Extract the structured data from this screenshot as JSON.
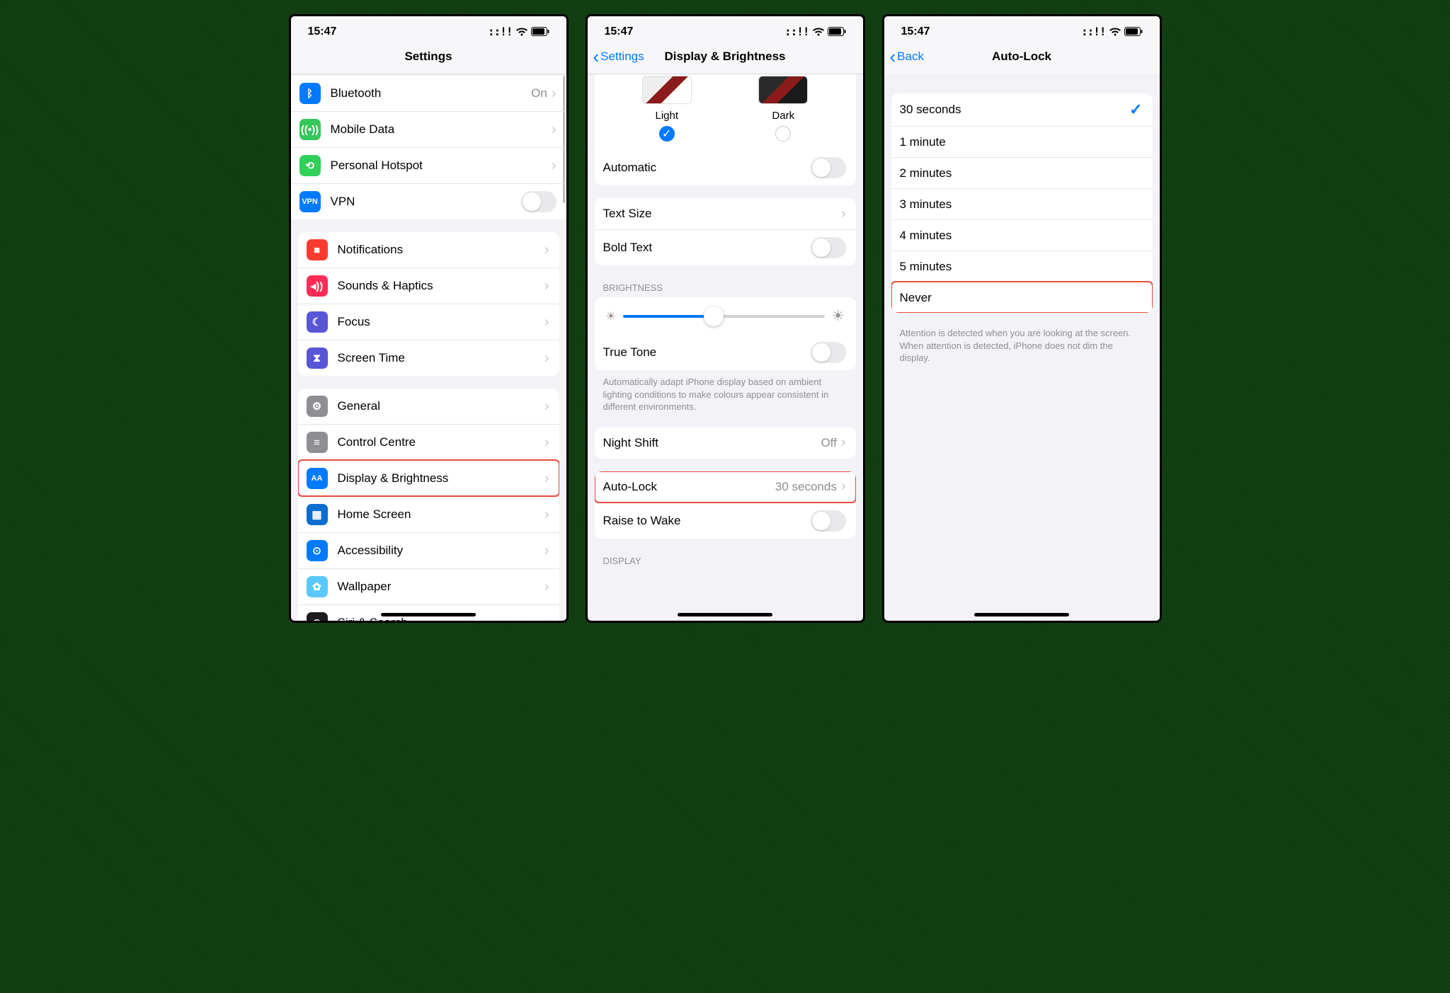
{
  "status": {
    "time": "15:47",
    "signal": "::!!"
  },
  "p1": {
    "title": "Settings",
    "g1": [
      {
        "icon": "bluetooth",
        "color": "bg-blue",
        "label": "Bluetooth",
        "value": "On"
      },
      {
        "icon": "antenna",
        "color": "bg-green",
        "label": "Mobile Data",
        "value": ""
      },
      {
        "icon": "link",
        "color": "bg-green2",
        "label": "Personal Hotspot",
        "value": ""
      },
      {
        "icon": "VPN",
        "color": "bg-blue",
        "label": "VPN",
        "value": "",
        "switch": true
      }
    ],
    "g2": [
      {
        "icon": "bell",
        "color": "bg-red",
        "label": "Notifications"
      },
      {
        "icon": "speaker",
        "color": "bg-pink",
        "label": "Sounds & Haptics"
      },
      {
        "icon": "moon",
        "color": "bg-indigo",
        "label": "Focus"
      },
      {
        "icon": "hourglass",
        "color": "bg-indigo",
        "label": "Screen Time"
      }
    ],
    "g3": [
      {
        "icon": "gear",
        "color": "bg-gray",
        "label": "General"
      },
      {
        "icon": "switches",
        "color": "bg-gray",
        "label": "Control Centre"
      },
      {
        "icon": "AA",
        "color": "bg-blue",
        "label": "Display & Brightness",
        "hl": true
      },
      {
        "icon": "grid",
        "color": "bg-darkblue",
        "label": "Home Screen"
      },
      {
        "icon": "person",
        "color": "bg-blue",
        "label": "Accessibility"
      },
      {
        "icon": "flower",
        "color": "bg-cyan",
        "label": "Wallpaper"
      },
      {
        "icon": "siri",
        "color": "bg-black",
        "label": "Siri & Search"
      },
      {
        "icon": "faceid",
        "color": "bg-green",
        "label": ""
      }
    ]
  },
  "p2": {
    "back": "Settings",
    "title": "Display & Brightness",
    "light": "Light",
    "dark": "Dark",
    "automatic": "Automatic",
    "textsize": "Text Size",
    "bold": "Bold Text",
    "brightness_hdr": "BRIGHTNESS",
    "truetone": "True Tone",
    "truetone_foot": "Automatically adapt iPhone display based on ambient lighting conditions to make colours appear consistent in different environments.",
    "nightshift": "Night Shift",
    "nightshift_val": "Off",
    "autolock": "Auto-Lock",
    "autolock_val": "30 seconds",
    "raise": "Raise to Wake",
    "display_hdr": "DISPLAY"
  },
  "p3": {
    "back": "Back",
    "title": "Auto-Lock",
    "options": [
      {
        "label": "30 seconds",
        "checked": true
      },
      {
        "label": "1 minute"
      },
      {
        "label": "2 minutes"
      },
      {
        "label": "3 minutes"
      },
      {
        "label": "4 minutes"
      },
      {
        "label": "5 minutes"
      },
      {
        "label": "Never",
        "hl": true
      }
    ],
    "footer": "Attention is detected when you are looking at the screen. When attention is detected, iPhone does not dim the display."
  }
}
